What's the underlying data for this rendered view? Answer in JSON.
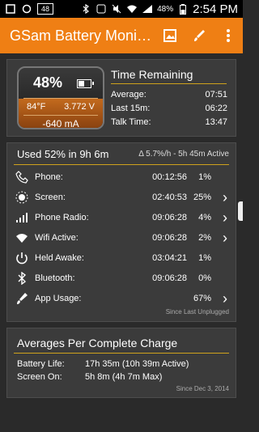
{
  "status_bar": {
    "left_icons": [
      "notification-icon",
      "refresh-icon",
      "badge-48-icon"
    ],
    "badge_text": "48",
    "battery_pct": "48%",
    "time": "2:54 PM"
  },
  "app_bar": {
    "title": "GSam Battery Moni…"
  },
  "battery_card": {
    "percent": "48%",
    "temperature": "84°F",
    "voltage": "3.772 V",
    "current": "-640 mA",
    "level": 0.48
  },
  "time_remaining": {
    "title": "Time Remaining",
    "rows": [
      {
        "label": "Average:",
        "value": "07:51"
      },
      {
        "label": "Last 15m:",
        "value": "06:22"
      },
      {
        "label": "Talk Time:",
        "value": "13:47"
      }
    ]
  },
  "usage": {
    "header": "Used 52% in 9h 6m",
    "rate": "Δ 5.7%/h - 5h 45m Active",
    "rows": [
      {
        "label": "Phone:",
        "time": "00:12:56",
        "pct": "1%",
        "chevron": ""
      },
      {
        "label": "Screen:",
        "time": "02:40:53",
        "pct": "25%",
        "chevron": "›"
      },
      {
        "label": "Phone Radio:",
        "time": "09:06:28",
        "pct": "4%",
        "chevron": "›"
      },
      {
        "label": "Wifi Active:",
        "time": "09:06:28",
        "pct": "2%",
        "chevron": "›"
      },
      {
        "label": "Held Awake:",
        "time": "03:04:21",
        "pct": "1%",
        "chevron": ""
      },
      {
        "label": "Bluetooth:",
        "time": "09:06:28",
        "pct": "0%",
        "chevron": ""
      },
      {
        "label": "App Usage:",
        "time": "",
        "pct": "67%",
        "chevron": "›"
      }
    ],
    "since": "Since Last Unplugged"
  },
  "averages": {
    "title": "Averages Per Complete Charge",
    "rows": [
      {
        "label": "Battery Life:",
        "value": "17h 35m (10h 39m Active)"
      },
      {
        "label": "Screen On:",
        "value": "5h 8m (4h 7m Max)"
      }
    ],
    "since": "Since Dec 3, 2014"
  },
  "colors": {
    "accent": "#ef7f14",
    "divider": "#cfa21c",
    "card": "#3b3b3b"
  }
}
